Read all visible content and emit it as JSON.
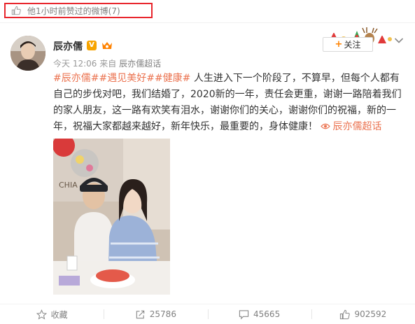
{
  "banner": {
    "text": "他1小时前赞过的微博(7)"
  },
  "post": {
    "author": "辰亦儒",
    "meta": {
      "time": "今天 12:06",
      "from_label": "来自",
      "source": "辰亦儒超话"
    },
    "follow_label": "关注",
    "tags": [
      "#辰亦儒#",
      "#遇见美好#",
      "#健康#"
    ],
    "body": "人生进入下一个阶段了，不算早，但每个人都有自己的步伐对吧，我们结婚了，2020新的一年，责任会更重，谢谢一路陪着我们的家人朋友，这一路有欢笑有泪水，谢谢你们的关心，谢谢你们的祝福，新的一年，祝福大家都越来越好，新年快乐，最重要的，身体健康！",
    "super_topic_link": "辰亦儒超话"
  },
  "actions": [
    {
      "id": "favorite",
      "label": "收藏",
      "icon": "star-icon"
    },
    {
      "id": "repost",
      "label": "25786",
      "icon": "repost-icon"
    },
    {
      "id": "comment",
      "label": "45665",
      "icon": "comment-icon"
    },
    {
      "id": "like",
      "label": "902592",
      "icon": "thumb-up-icon"
    }
  ],
  "colors": {
    "accent_orange": "#eb7350",
    "banner_border": "#e8262d",
    "text_main": "#333333",
    "text_muted": "#808080"
  }
}
